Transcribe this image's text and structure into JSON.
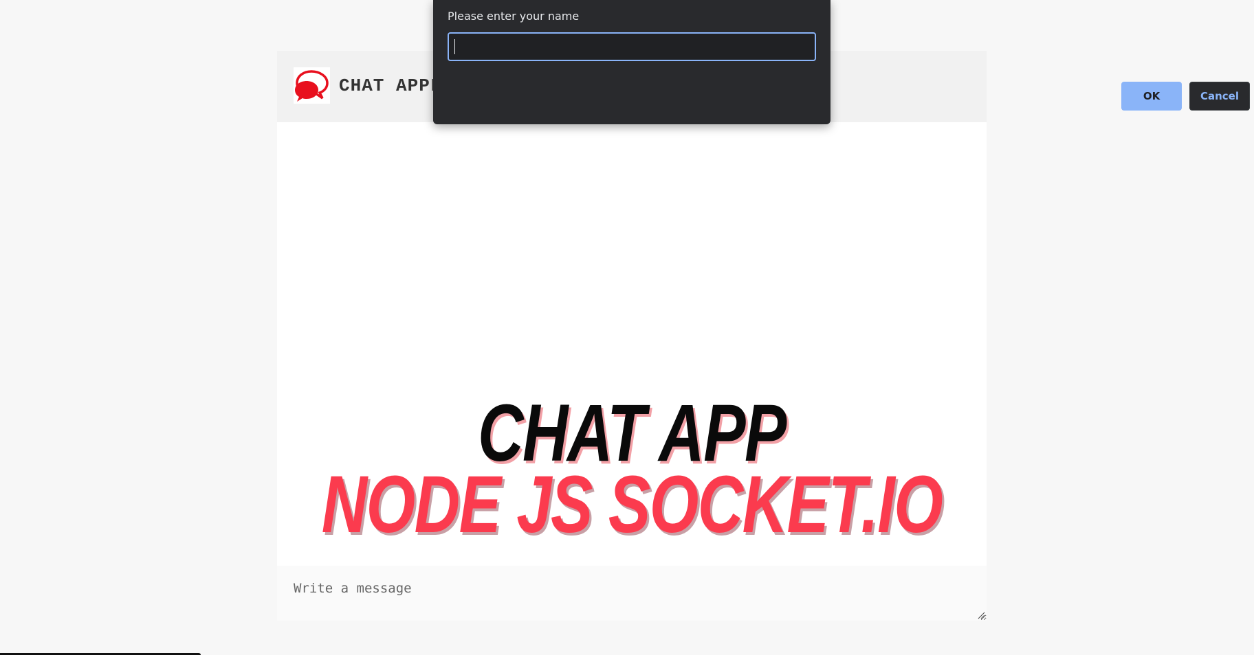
{
  "app": {
    "title": "CHAT APPLI",
    "logo_icon": "chat-bubbles-icon"
  },
  "overlay": {
    "line1": "CHAT APP",
    "line2": "NODE JS SOCKET.IO"
  },
  "composer": {
    "placeholder": "Write a message"
  },
  "dialog": {
    "message": "Please enter your name",
    "input_value": "",
    "ok_label": "OK",
    "cancel_label": "Cancel"
  },
  "colors": {
    "accent_red": "#fb3b4e",
    "dialog_bg": "#292a2d",
    "dialog_accent": "#8ab4f8",
    "header_bg": "#f1f1f1",
    "page_bg": "#f7f7f7"
  }
}
